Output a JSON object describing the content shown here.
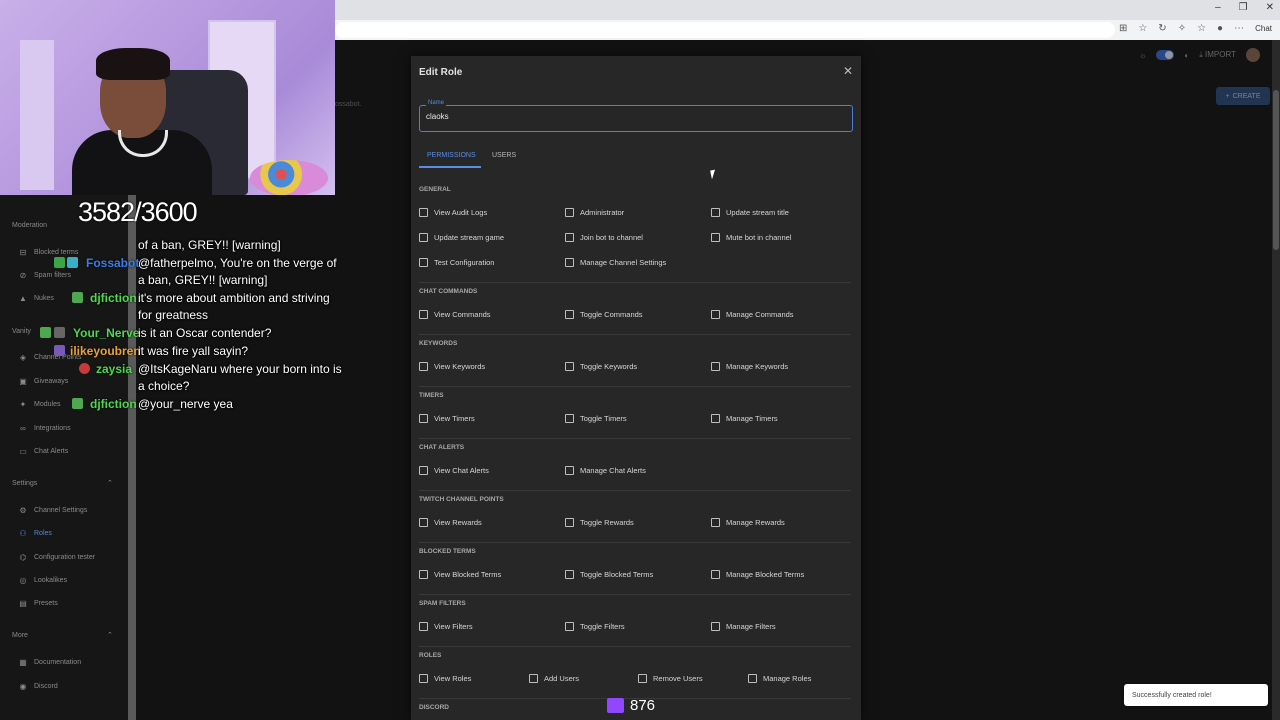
{
  "browser": {
    "window_controls": [
      "–",
      "❐",
      "✕"
    ],
    "chat_label": "Chat"
  },
  "header": {
    "import_label": "IMPORT",
    "create_label": "CREATE",
    "snippet": "ossabot."
  },
  "sidebar": {
    "moderation_label": "Moderation",
    "vanity_label": "Vanity",
    "settings_label": "Settings",
    "more_label": "More",
    "items": [
      {
        "label": "Blocked terms",
        "icon": "block-icon"
      },
      {
        "label": "Spam filters",
        "icon": "filter-icon"
      },
      {
        "label": "Nukes",
        "icon": "warning-icon"
      },
      {
        "label": "Channel Points",
        "icon": "points-icon"
      },
      {
        "label": "Giveaways",
        "icon": "gift-icon"
      },
      {
        "label": "Modules",
        "icon": "sparkle-icon"
      },
      {
        "label": "Integrations",
        "icon": "link-icon"
      },
      {
        "label": "Chat Alerts",
        "icon": "chat-icon"
      },
      {
        "label": "Channel Settings",
        "icon": "gear-icon"
      },
      {
        "label": "Roles",
        "icon": "users-icon"
      },
      {
        "label": "Configuration tester",
        "icon": "tester-icon"
      },
      {
        "label": "Lookalikes",
        "icon": "lookalike-icon"
      },
      {
        "label": "Presets",
        "icon": "preset-icon"
      },
      {
        "label": "Documentation",
        "icon": "doc-icon"
      },
      {
        "label": "Discord",
        "icon": "discord-icon"
      }
    ]
  },
  "stream": {
    "sub_count": "3582/3600",
    "follower_count": "876",
    "chat": [
      {
        "user": "",
        "user_color": "#ffffff",
        "text": "of a ban, GREY!! [warning]"
      },
      {
        "user": "Fossabot",
        "user_color": "#3a7ee8",
        "text": "@fatherpelmo, You're on the verge of"
      },
      {
        "user": "",
        "user_color": "#ffffff",
        "text": "a ban, GREY!! [warning]"
      },
      {
        "user": "djfiction",
        "user_color": "#4fd84f",
        "text": "it's more about ambition and striving"
      },
      {
        "user": "",
        "user_color": "#ffffff",
        "text": "for greatness"
      },
      {
        "user": "Your_Nerve",
        "user_color": "#4fd84f",
        "text": "is it an Oscar contender?"
      },
      {
        "user": "ilikeyoubren",
        "user_color": "#e8a23a",
        "text": "it was fire yall sayin?"
      },
      {
        "user": "zaysia",
        "user_color": "#4fd84f",
        "text": "@ItsKageNaru where your born into is"
      },
      {
        "user": "",
        "user_color": "#ffffff",
        "text": "a choice?"
      },
      {
        "user": "djfiction",
        "user_color": "#4fd84f",
        "text": "@your_nerve yea"
      }
    ]
  },
  "modal": {
    "title": "Edit Role",
    "name_label": "Name",
    "name_value": "claoks",
    "tabs": [
      "PERMISSIONS",
      "USERS"
    ],
    "sections": [
      {
        "title": "GENERAL",
        "rows": [
          [
            "View Audit Logs",
            "Administrator",
            "Update stream title"
          ],
          [
            "Update stream game",
            "Join bot to channel",
            "Mute bot in channel"
          ],
          [
            "Test Configuration",
            "Manage Channel Settings"
          ]
        ]
      },
      {
        "title": "CHAT COMMANDS",
        "rows": [
          [
            "View Commands",
            "Toggle Commands",
            "Manage Commands"
          ]
        ]
      },
      {
        "title": "KEYWORDS",
        "rows": [
          [
            "View Keywords",
            "Toggle Keywords",
            "Manage Keywords"
          ]
        ]
      },
      {
        "title": "TIMERS",
        "rows": [
          [
            "View Timers",
            "Toggle Timers",
            "Manage Timers"
          ]
        ]
      },
      {
        "title": "CHAT ALERTS",
        "rows": [
          [
            "View Chat Alerts",
            "Manage Chat Alerts"
          ]
        ]
      },
      {
        "title": "TWITCH CHANNEL POINTS",
        "rows": [
          [
            "View Rewards",
            "Toggle Rewards",
            "Manage Rewards"
          ]
        ]
      },
      {
        "title": "BLOCKED TERMS",
        "rows": [
          [
            "View Blocked Terms",
            "Toggle Blocked Terms",
            "Manage Blocked Terms"
          ]
        ]
      },
      {
        "title": "SPAM FILTERS",
        "rows": [
          [
            "View Filters",
            "Toggle Filters",
            "Manage Filters"
          ]
        ]
      },
      {
        "title": "ROLES",
        "rows": [
          [
            "View Roles",
            "Add Users",
            "Remove Users",
            "Manage Roles"
          ]
        ]
      },
      {
        "title": "DISCORD",
        "rows": []
      }
    ]
  },
  "toast": {
    "message": "Successfully created role!"
  }
}
